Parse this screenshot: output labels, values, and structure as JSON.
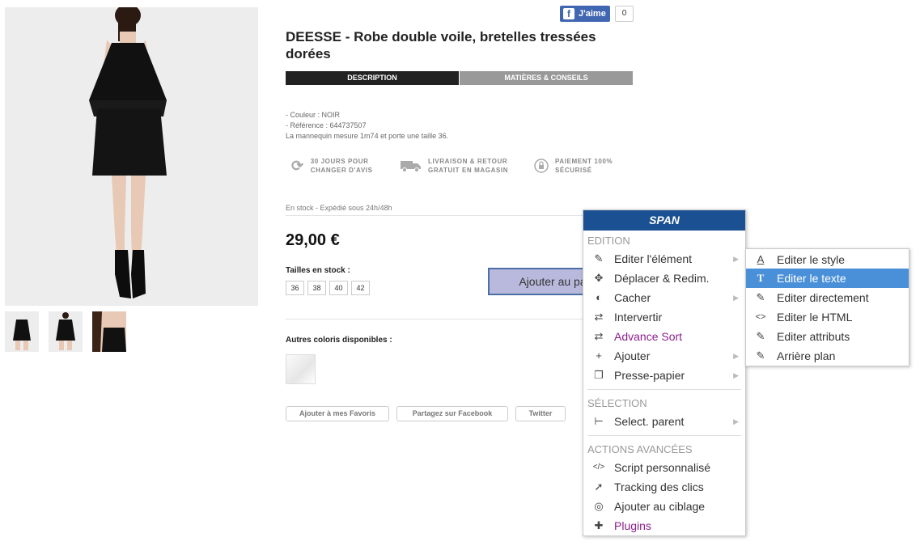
{
  "facebook": {
    "like_label": "J'aime",
    "count": "0"
  },
  "product": {
    "title": "DEESSE - Robe double voile, bretelles tressées dorées",
    "tabs": [
      "DESCRIPTION",
      "MATIÈRES & CONSEILS"
    ],
    "specs": [
      "- Couleur : NOIR",
      "- Référence : 644737507",
      "La mannequin mesure 1m74 et porte une taille 36."
    ],
    "features": [
      {
        "icon": "refresh-icon",
        "line1": "30 JOURS POUR",
        "line2": "CHANGER D'AVIS"
      },
      {
        "icon": "truck-icon",
        "line1": "LIVRAISON & RETOUR",
        "line2": "GRATUIT EN MAGASIN"
      },
      {
        "icon": "lock-icon",
        "line1": "PAIEMENT 100%",
        "line2": "SÉCURISÉ"
      }
    ],
    "stock": "En stock - Expédié sous 24h/48h",
    "price": "29,00 €",
    "sizes_label": "Tailles en stock :",
    "sizes": [
      "36",
      "38",
      "40",
      "42"
    ],
    "add_to_cart": "Ajouter au pa",
    "colors_label": "Autres coloris disponibles :",
    "share": [
      "Ajouter à mes Favoris",
      "Partagez sur Facebook",
      "Twitter"
    ]
  },
  "context_menu": {
    "header": "SPAN",
    "sections": {
      "edition": "EDITION",
      "selection": "SÉLECTION",
      "advanced": "ACTIONS AVANCÉES"
    },
    "edition_items": [
      {
        "icon": "pencil-icon",
        "label": "Editer l'élément",
        "submenu": true
      },
      {
        "icon": "move-icon",
        "label": "Déplacer & Redim.",
        "submenu": false
      },
      {
        "icon": "eye-slash-icon",
        "label": "Cacher",
        "submenu": true
      },
      {
        "icon": "swap-icon",
        "label": "Intervertir",
        "submenu": false
      },
      {
        "icon": "swap-icon",
        "label": "Advance Sort",
        "submenu": false
      },
      {
        "icon": "plus-icon",
        "label": "Ajouter",
        "submenu": true
      },
      {
        "icon": "clipboard-icon",
        "label": "Presse-papier",
        "submenu": true
      }
    ],
    "selection_items": [
      {
        "icon": "tree-icon",
        "label": "Select. parent",
        "submenu": true
      }
    ],
    "advanced_items": [
      {
        "icon": "code-icon",
        "label": "Script personnalisé"
      },
      {
        "icon": "cursor-icon",
        "label": "Tracking des clics"
      },
      {
        "icon": "target-icon",
        "label": "Ajouter au ciblage"
      },
      {
        "icon": "puzzle-icon",
        "label": "Plugins"
      }
    ],
    "submenu_items": [
      {
        "icon": "font-style-icon",
        "label": "Editer le style"
      },
      {
        "icon": "text-icon",
        "label": "Editer le texte",
        "active": true
      },
      {
        "icon": "pencil-icon",
        "label": "Editer directement"
      },
      {
        "icon": "html-icon",
        "label": "Editer le HTML"
      },
      {
        "icon": "pencil-icon",
        "label": "Editer attributs"
      },
      {
        "icon": "pencil-icon",
        "label": "Arrière plan"
      }
    ],
    "colors": {
      "header": "#1b5192",
      "active": "#4a90d9",
      "purple": "#8b1e8b"
    }
  }
}
